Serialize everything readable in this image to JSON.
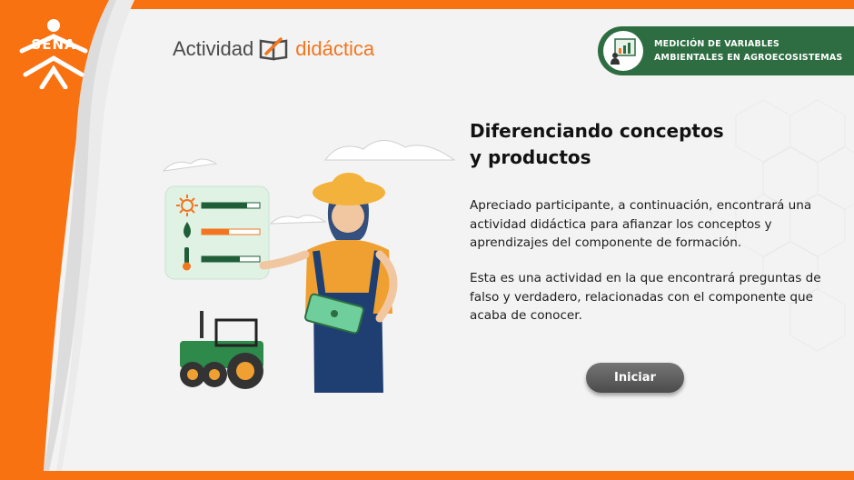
{
  "brand": {
    "logo_text": "SENA"
  },
  "activity_title": {
    "part1": "Actividad",
    "part2": "didáctica"
  },
  "course_badge": {
    "line1": "MEDICIÓN DE VARIABLES",
    "line2": "AMBIENTALES EN AGROECOSISTEMAS",
    "icon": "chart-presentation-icon"
  },
  "content": {
    "heading_line1": "Diferenciando conceptos",
    "heading_line2": "y productos",
    "paragraph1": "Apreciado participante, a continuación, encontrará una actividad didáctica para afianzar los conceptos y aprendizajes del componente de formación.",
    "paragraph2": "Esta es una actividad en la que encontrará preguntas de falso y verdadero, relacionadas con el componente que acaba de conocer."
  },
  "start_button": {
    "label": "Iniciar"
  },
  "illustration": {
    "icons": [
      "sun-icon",
      "water-drop-icon",
      "thermometer-icon",
      "tractor-icon",
      "farmer-woman-icon",
      "tablet-icon"
    ],
    "levels": {
      "sun": 0.9,
      "water": 0.45,
      "temperature": 0.65
    },
    "colors": {
      "orange": "#f37520",
      "green": "#2d6d41",
      "bar_green": "#1f5e38"
    }
  }
}
